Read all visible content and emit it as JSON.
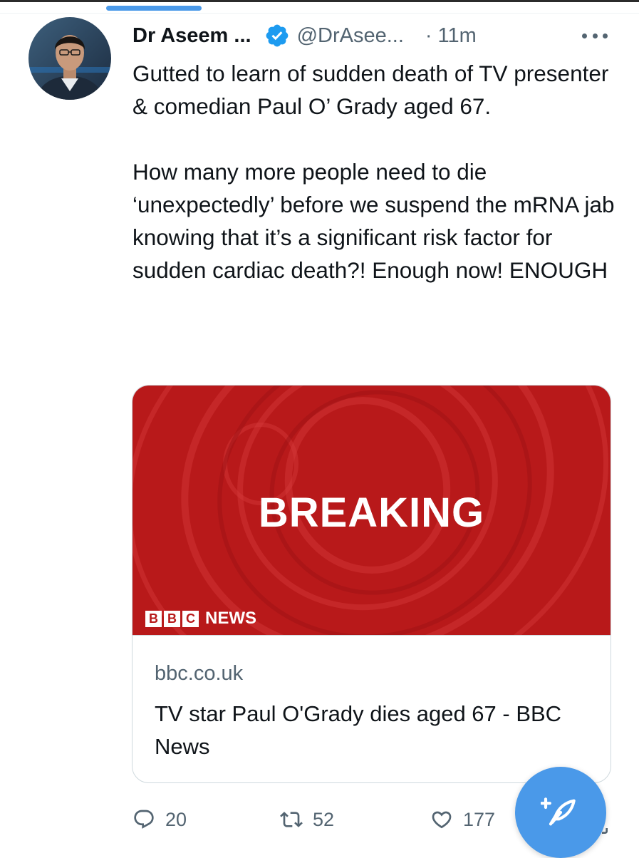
{
  "tweet": {
    "author_name": "Dr Aseem ...",
    "handle": "@DrAsee...",
    "separator": "·",
    "time": "11m",
    "text_paragraph_1": "Gutted to learn of sudden death of TV presenter & comedian Paul O’ Grady aged 67.",
    "text_paragraph_2": "How many more people need to die ‘unexpectedly’ before we suspend the mRNA jab knowing that it’s a significant risk factor for sudden cardiac death?! Enough now! ENOUGH"
  },
  "card": {
    "image_headline": "BREAKING",
    "logo_letters": [
      "B",
      "B",
      "C"
    ],
    "logo_word": "NEWS",
    "domain": "bbc.co.uk",
    "title": "TV star Paul O'Grady dies aged 67 - BBC News"
  },
  "actions": {
    "reply_count": "20",
    "retweet_count": "52",
    "like_count": "177"
  },
  "icons": {
    "verified": "verified-badge-icon",
    "more": "more-options-icon",
    "reply": "reply-icon",
    "retweet": "retweet-icon",
    "like": "heart-icon",
    "compose": "compose-feather-icon",
    "share": "share-icon"
  },
  "colors": {
    "accent_blue": "#4a99e9",
    "verified_blue": "#1d9bf0",
    "bbc_red": "#b8191a",
    "muted_text": "#536471",
    "main_text": "#0f1419"
  }
}
